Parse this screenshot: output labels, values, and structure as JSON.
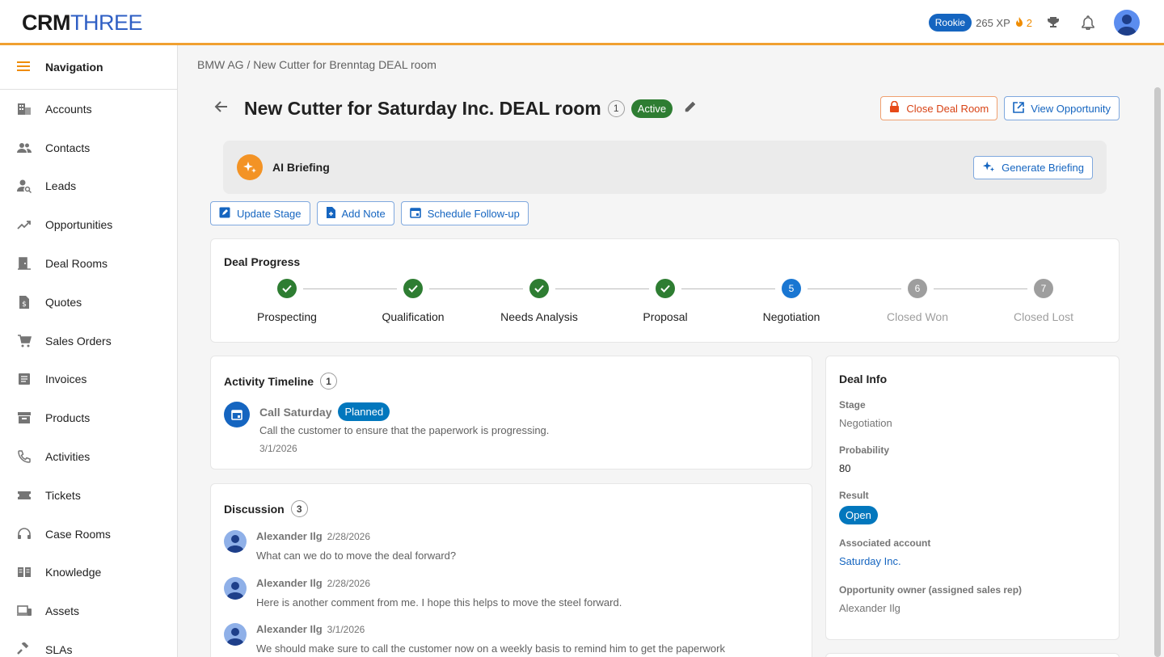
{
  "app": {
    "logo_part1": "CRM",
    "logo_part2": "THREE",
    "level": "Rookie",
    "xp": "265 XP",
    "streak": "2"
  },
  "sidebar": {
    "header": "Navigation",
    "items": [
      {
        "label": "Accounts",
        "icon": "building-icon"
      },
      {
        "label": "Contacts",
        "icon": "people-icon"
      },
      {
        "label": "Leads",
        "icon": "person-search-icon"
      },
      {
        "label": "Opportunities",
        "icon": "trending-up-icon"
      },
      {
        "label": "Deal Rooms",
        "icon": "door-icon"
      },
      {
        "label": "Quotes",
        "icon": "quote-doc-icon"
      },
      {
        "label": "Sales Orders",
        "icon": "cart-icon"
      },
      {
        "label": "Invoices",
        "icon": "invoice-icon"
      },
      {
        "label": "Products",
        "icon": "archive-box-icon"
      },
      {
        "label": "Activities",
        "icon": "phone-icon"
      },
      {
        "label": "Tickets",
        "icon": "ticket-icon"
      },
      {
        "label": "Case Rooms",
        "icon": "headset-icon"
      },
      {
        "label": "Knowledge",
        "icon": "book-icon"
      },
      {
        "label": "Assets",
        "icon": "devices-icon"
      },
      {
        "label": "SLAs",
        "icon": "gavel-icon"
      }
    ]
  },
  "page": {
    "breadcrumb": "BMW AG / New Cutter for Brenntag DEAL room",
    "title": "New Cutter for Saturday Inc. DEAL room",
    "count": "1",
    "status": "Active",
    "close_btn": "Close Deal Room",
    "view_btn": "View Opportunity"
  },
  "ai": {
    "title": "AI Briefing",
    "button": "Generate Briefing"
  },
  "actions": {
    "update_stage": "Update Stage",
    "add_note": "Add Note",
    "schedule": "Schedule Follow-up"
  },
  "progress": {
    "title": "Deal Progress",
    "steps": [
      {
        "label": "Prospecting",
        "state": "done"
      },
      {
        "label": "Qualification",
        "state": "done"
      },
      {
        "label": "Needs Analysis",
        "state": "done"
      },
      {
        "label": "Proposal",
        "state": "done"
      },
      {
        "label": "Negotiation",
        "state": "current",
        "num": "5"
      },
      {
        "label": "Closed Won",
        "state": "future",
        "num": "6"
      },
      {
        "label": "Closed Lost",
        "state": "future",
        "num": "7"
      }
    ]
  },
  "timeline": {
    "title": "Activity Timeline",
    "count": "1",
    "entry": {
      "name": "Call Saturday",
      "badge": "Planned",
      "text": "Call the customer to ensure that the paperwork is progressing.",
      "date": "3/1/2026"
    }
  },
  "discussion": {
    "title": "Discussion",
    "count": "3",
    "comments": [
      {
        "author": "Alexander Ilg",
        "date": "2/28/2026",
        "text": "What can we do to move the deal forward?"
      },
      {
        "author": "Alexander Ilg",
        "date": "2/28/2026",
        "text": "Here is another comment from me. I hope this helps to move the steel forward."
      },
      {
        "author": "Alexander Ilg",
        "date": "3/1/2026",
        "text": "We should make sure to call the customer now on a weekly basis to remind him to get the paperwork"
      }
    ]
  },
  "deal_info": {
    "title": "Deal Info",
    "stage_label": "Stage",
    "stage": "Negotiation",
    "probability_label": "Probability",
    "probability": "80",
    "result_label": "Result",
    "result": "Open",
    "account_label": "Associated account",
    "account": "Saturday Inc.",
    "owner_label": "Opportunity owner (assigned sales rep)",
    "owner": "Alexander Ilg"
  }
}
